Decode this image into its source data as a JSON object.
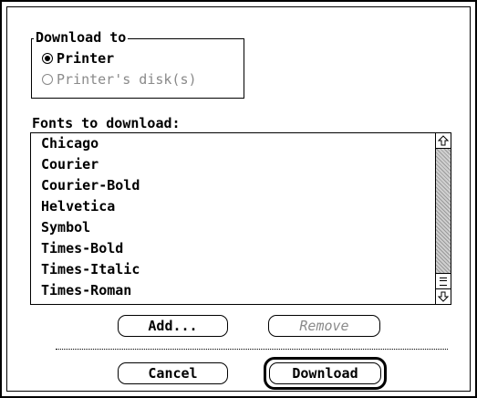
{
  "download_to": {
    "title": "Download to",
    "options": [
      {
        "label": "Printer",
        "selected": true,
        "enabled": true
      },
      {
        "label": "Printer's disk(s)",
        "selected": false,
        "enabled": false
      }
    ]
  },
  "fonts": {
    "title": "Fonts to download:",
    "items": [
      "Chicago",
      "Courier",
      "Courier-Bold",
      "Helvetica",
      "Symbol",
      "Times-Bold",
      "Times-Italic",
      "Times-Roman"
    ],
    "scrollbar": {
      "up_icon": "up-arrow-icon",
      "down_icon": "down-arrow-icon",
      "thumb_icon": "scroll-thumb-icon"
    }
  },
  "buttons": {
    "add": "Add...",
    "remove": "Remove",
    "cancel": "Cancel",
    "download": "Download"
  },
  "colors": {
    "disabled_text": "#8a8a8a",
    "track": "#cfcfcf"
  }
}
